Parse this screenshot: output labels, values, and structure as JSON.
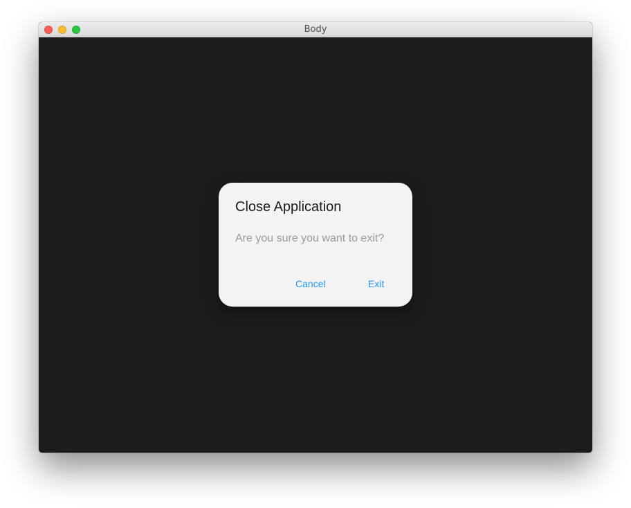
{
  "window": {
    "title": "Body"
  },
  "dialog": {
    "title": "Close Application",
    "message": "Are you sure you want to exit?",
    "cancel_label": "Cancel",
    "exit_label": "Exit"
  },
  "colors": {
    "background": "#1c1c1c",
    "dialog_background": "#f3f3f3",
    "accent": "#2196f3",
    "message_text": "#9a9a9a"
  },
  "icons": {
    "close": "close-window-icon",
    "minimize": "minimize-window-icon",
    "zoom": "zoom-window-icon"
  }
}
